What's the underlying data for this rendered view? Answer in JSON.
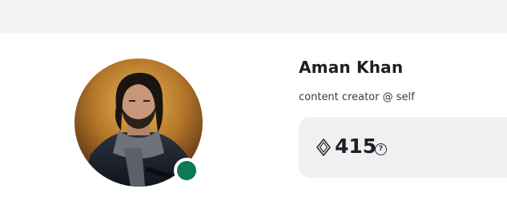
{
  "profile": {
    "name": "Aman Khan",
    "bio": "content creator @ self",
    "avatar_icon": "avatar-photo",
    "online_status_color": "#0b7a55"
  },
  "points": {
    "value": "415",
    "currency_icon": "gem-icon",
    "help_icon_glyph": "?"
  }
}
